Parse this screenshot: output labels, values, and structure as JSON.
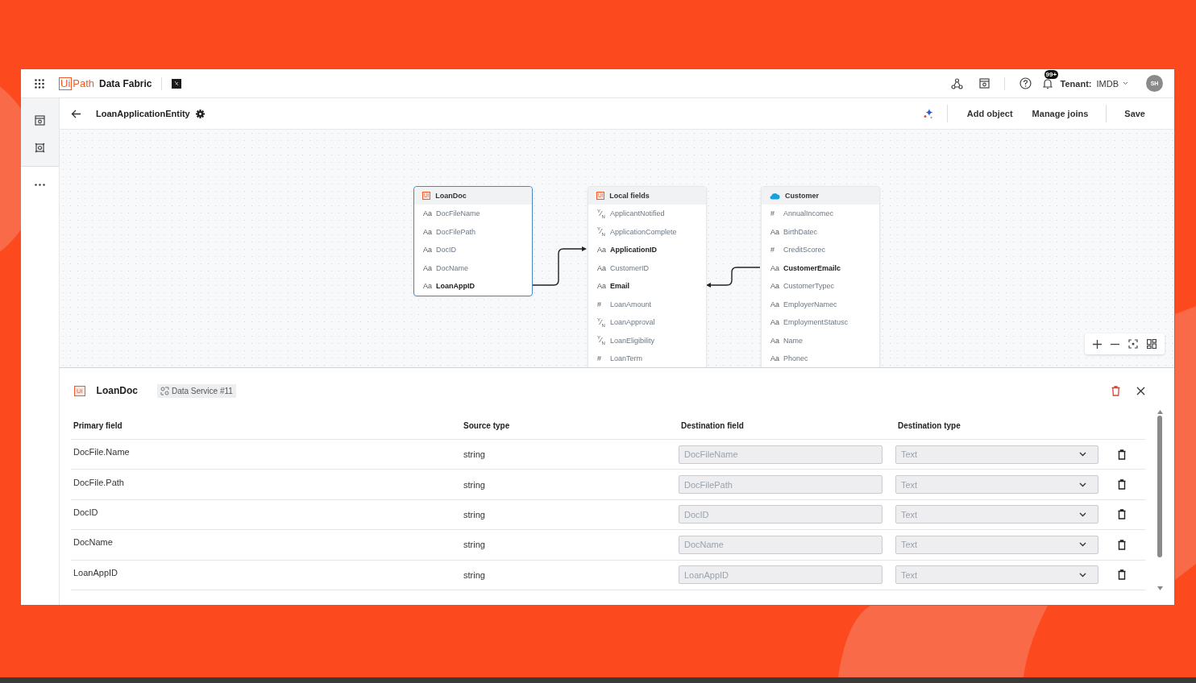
{
  "topbar": {
    "logo_mark": "Ui",
    "logo_word": "Path",
    "product": "Data Fabric",
    "notification_count": "99+",
    "tenant_label": "Tenant:",
    "tenant": "IMDB",
    "avatar": "SH"
  },
  "toolbar": {
    "title": "LoanApplicationEntity",
    "actions": [
      "Add object",
      "Manage joins"
    ],
    "save": "Save"
  },
  "entities": [
    {
      "name": "LoanDoc",
      "kind": "uipath",
      "badge": "Ui",
      "selected": true,
      "fields": [
        {
          "glyph": "Aa",
          "name": "DocFileName",
          "key": false
        },
        {
          "glyph": "Aa",
          "name": "DocFilePath",
          "key": false
        },
        {
          "glyph": "Aa",
          "name": "DocID",
          "key": false
        },
        {
          "glyph": "Aa",
          "name": "DocName",
          "key": false
        },
        {
          "glyph": "Aa",
          "name": "LoanAppID",
          "key": true
        }
      ]
    },
    {
      "name": "Local fields",
      "kind": "uipath",
      "badge": "Ui",
      "selected": false,
      "fields": [
        {
          "glyph": "$^{Y}$⁄$_{N}$",
          "name": "ApplicantNotified",
          "key": false
        },
        {
          "glyph": "$^{Y}$⁄$_{N}$",
          "name": "ApplicationComplete",
          "key": false
        },
        {
          "glyph": "Aa",
          "name": "ApplicationID",
          "key": true
        },
        {
          "glyph": "Aa",
          "name": "CustomerID",
          "key": false
        },
        {
          "glyph": "Aa",
          "name": "Email",
          "key": true
        },
        {
          "glyph": "#",
          "name": "LoanAmount",
          "key": false
        },
        {
          "glyph": "$^{Y}$⁄$_{N}$",
          "name": "LoanApproval",
          "key": false
        },
        {
          "glyph": "$^{Y}$⁄$_{N}$",
          "name": "LoanEligibility",
          "key": false
        },
        {
          "glyph": "#",
          "name": "LoanTerm",
          "key": false
        }
      ]
    },
    {
      "name": "Customer",
      "kind": "salesforce",
      "selected": false,
      "fields": [
        {
          "glyph": "#",
          "name": "AnnualIncomec",
          "key": false
        },
        {
          "glyph": "Aa",
          "name": "BirthDatec",
          "key": false
        },
        {
          "glyph": "#",
          "name": "CreditScorec",
          "key": false
        },
        {
          "glyph": "Aa",
          "name": "CustomerEmailc",
          "key": true
        },
        {
          "glyph": "Aa",
          "name": "CustomerTypec",
          "key": false
        },
        {
          "glyph": "Aa",
          "name": "EmployerNamec",
          "key": false
        },
        {
          "glyph": "Aa",
          "name": "EmploymentStatusc",
          "key": false
        },
        {
          "glyph": "Aa",
          "name": "Name",
          "key": false
        },
        {
          "glyph": "Aa",
          "name": "Phonec",
          "key": false
        }
      ]
    }
  ],
  "details": {
    "badge": "Ui",
    "name": "LoanDoc",
    "tag": "Data Service #11",
    "columns": [
      "Primary field",
      "Source type",
      "Destination field",
      "Destination type"
    ],
    "rows": [
      {
        "primary": "DocFile.Name",
        "source_type": "string",
        "destination_field": "DocFileName",
        "destination_type": "Text",
        "disabled": true
      },
      {
        "primary": "DocFile.Path",
        "source_type": "string",
        "destination_field": "DocFilePath",
        "destination_type": "Text",
        "disabled": true
      },
      {
        "primary": "DocID",
        "source_type": "string",
        "destination_field": "DocID",
        "destination_type": "Text",
        "disabled": true
      },
      {
        "primary": "DocName",
        "source_type": "string",
        "destination_field": "DocName",
        "destination_type": "Text",
        "disabled": true
      },
      {
        "primary": "LoanAppID",
        "source_type": "string",
        "destination_field": "LoanAppID",
        "destination_type": "Text",
        "disabled": true
      }
    ]
  }
}
